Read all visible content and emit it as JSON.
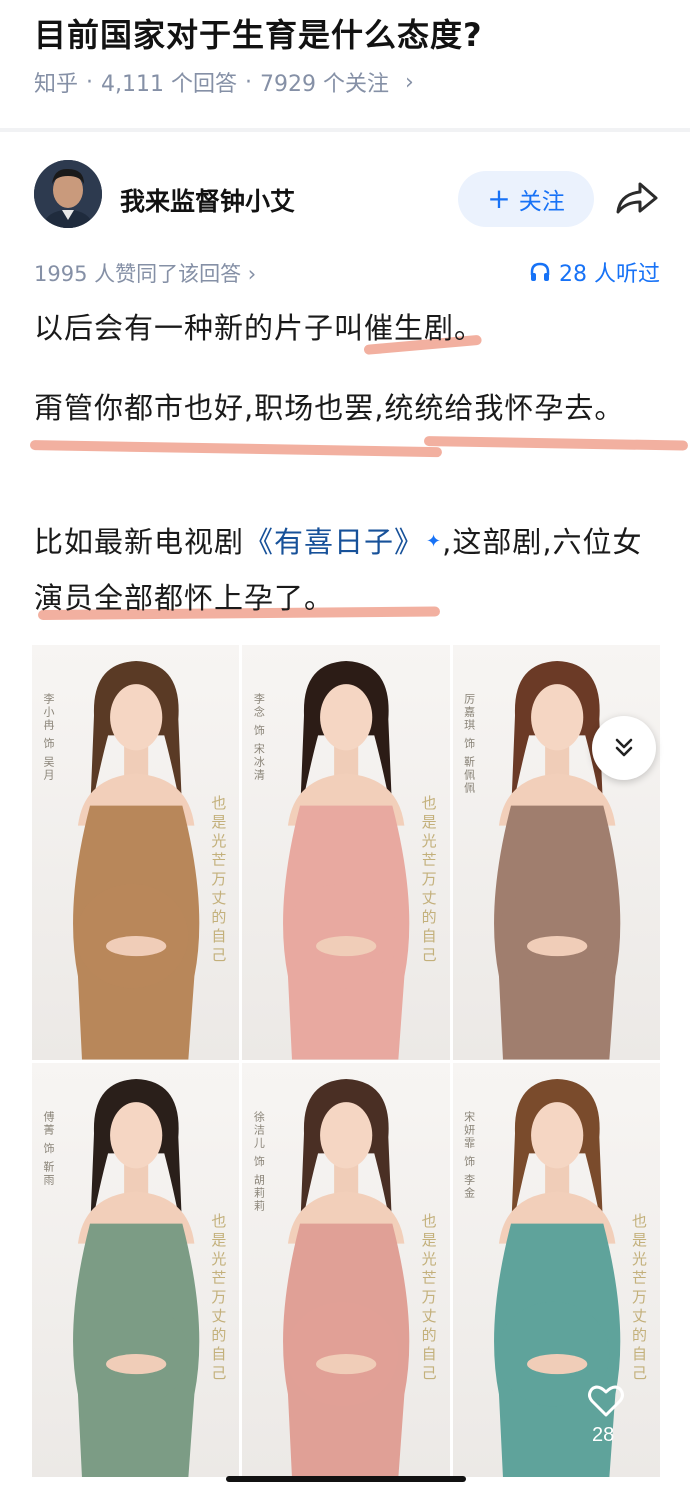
{
  "question": {
    "title": "目前国家对于生育是什么态度?",
    "source": "知乎",
    "sep1": "·",
    "answers": "4,111 个回答",
    "sep2": "·",
    "followers": "7929 个关注",
    "chevron": "›"
  },
  "author": {
    "name": "我来监督钟小艾",
    "follow_plus": "+",
    "follow_label": "关注",
    "share_icon": "share-icon"
  },
  "answer_meta": {
    "upvotes": "1995 人赞同了该回答 ›",
    "listen_icon": "headphones-icon",
    "listeners": "28 人听过"
  },
  "answer": {
    "p1": "以后会有一种新的片子叫催生剧。",
    "p2": "甭管你都市也好,职场也罢,统统给我怀孕去。",
    "p3_prefix": "比如最新电视剧",
    "p3_link": "《有喜日子》",
    "p3_sparkle": "✦",
    "p3_suffix": ",这部剧,六位女演员全部都怀上孕了。",
    "underline_color": "#ee9680"
  },
  "posters": [
    {
      "name": "李小冉 饰 吴月",
      "slogan": "也是光芒万丈的自己",
      "dress": "#b8875a",
      "hair": "#5a3a25"
    },
    {
      "name": "李念 饰 宋冰清",
      "slogan": "也是光芒万丈的自己",
      "dress": "#e8a9a0",
      "hair": "#2c1c16"
    },
    {
      "name": "厉嘉琪 饰 靳佩佩",
      "slogan": "",
      "dress": "#a07e6e",
      "hair": "#6b3a26"
    },
    {
      "name": "傅菁 饰 靳雨",
      "slogan": "也是光芒万丈的自己",
      "dress": "#7c9c85",
      "hair": "#2a1f1a"
    },
    {
      "name": "徐洁儿 饰 胡莉莉",
      "slogan": "也是光芒万丈的自己",
      "dress": "#e0a096",
      "hair": "#4a2f24"
    },
    {
      "name": "宋妍霏 饰 李金",
      "slogan": "也是光芒万丈的自己",
      "dress": "#5fa39b",
      "hair": "#7a4b2c"
    }
  ],
  "overlay": {
    "expand_icon": "chevron-double-down-icon",
    "like_icon": "heart-icon",
    "like_count": "28"
  },
  "colors": {
    "accent": "#1772f6",
    "meta": "#8590a6",
    "link": "#175199"
  }
}
